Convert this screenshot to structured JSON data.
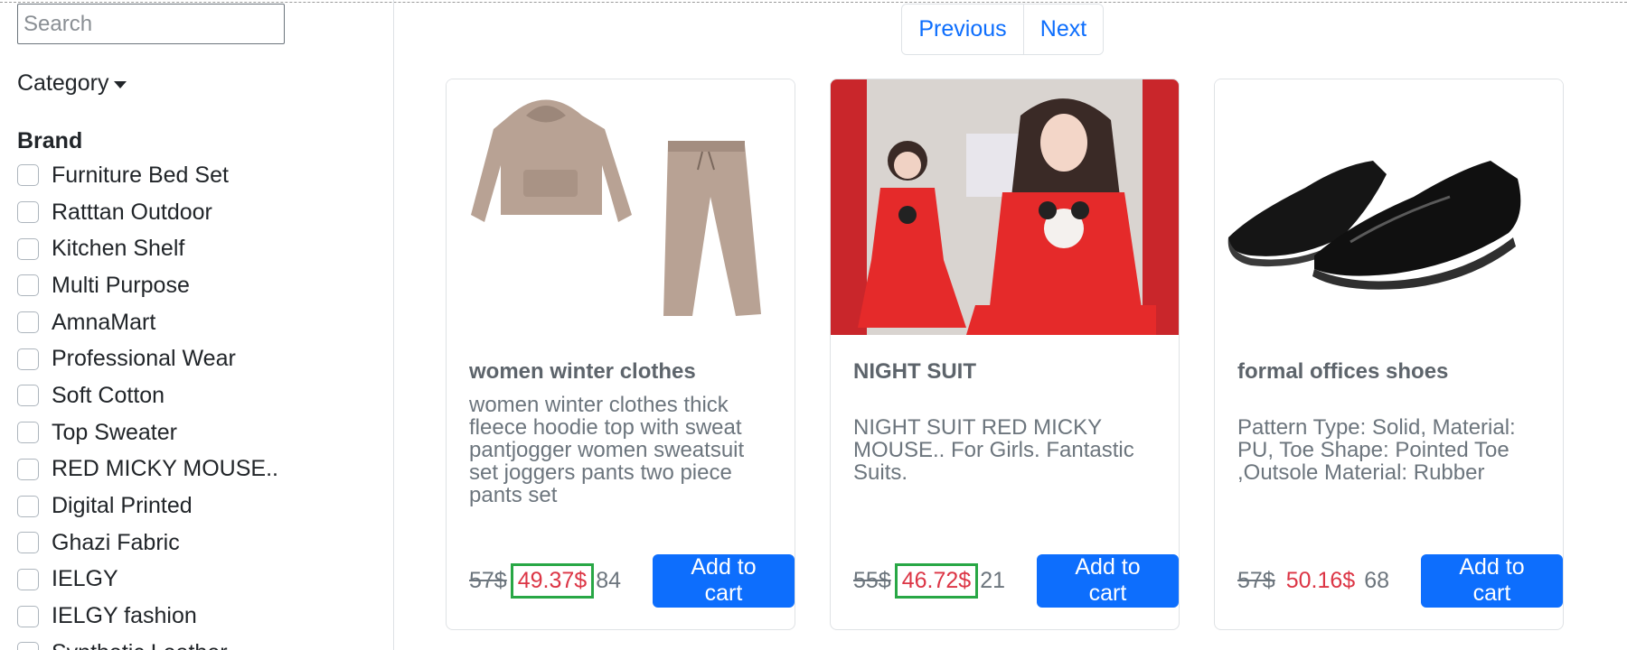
{
  "search": {
    "placeholder": "Search"
  },
  "sidebar": {
    "category_label": "Category",
    "brand_heading": "Brand",
    "brands": [
      "Furniture Bed Set",
      "Ratttan Outdoor",
      "Kitchen Shelf",
      "Multi Purpose",
      "AmnaMart",
      "Professional Wear",
      "Soft Cotton",
      "Top Sweater",
      "RED MICKY MOUSE..",
      "Digital Printed",
      "Ghazi Fabric",
      "IELGY",
      "IELGY fashion",
      "Synthetic Leather"
    ]
  },
  "pagination": {
    "previous": "Previous",
    "next": "Next"
  },
  "products": [
    {
      "title": "women winter clothes",
      "description": "women winter clothes thick fleece hoodie top with sweat pantjogger women sweatsuit set joggers pants two piece pants set",
      "old_price": "57$",
      "new_price": "49.37$",
      "stock": "84",
      "button": "Add to cart",
      "image": "hoodie-and-joggers-image"
    },
    {
      "title": "NIGHT SUIT",
      "description": "NIGHT SUIT RED MICKY MOUSE.. For Girls. Fantastic Suits.",
      "old_price": "55$",
      "new_price": "46.72$",
      "stock": "21",
      "button": "Add to cart",
      "image": "red-night-suit-image"
    },
    {
      "title": "formal offices shoes",
      "description": "Pattern Type: Solid, Material: PU, Toe Shape: Pointed Toe ,Outsole Material: Rubber",
      "old_price": "57$",
      "new_price": "50.16$",
      "stock": "68",
      "button": "Add to cart",
      "image": "black-formal-shoes-image"
    }
  ],
  "colors": {
    "primary": "#0d6efd",
    "sale_price": "#dc3545",
    "highlight_box": "#28a745"
  }
}
